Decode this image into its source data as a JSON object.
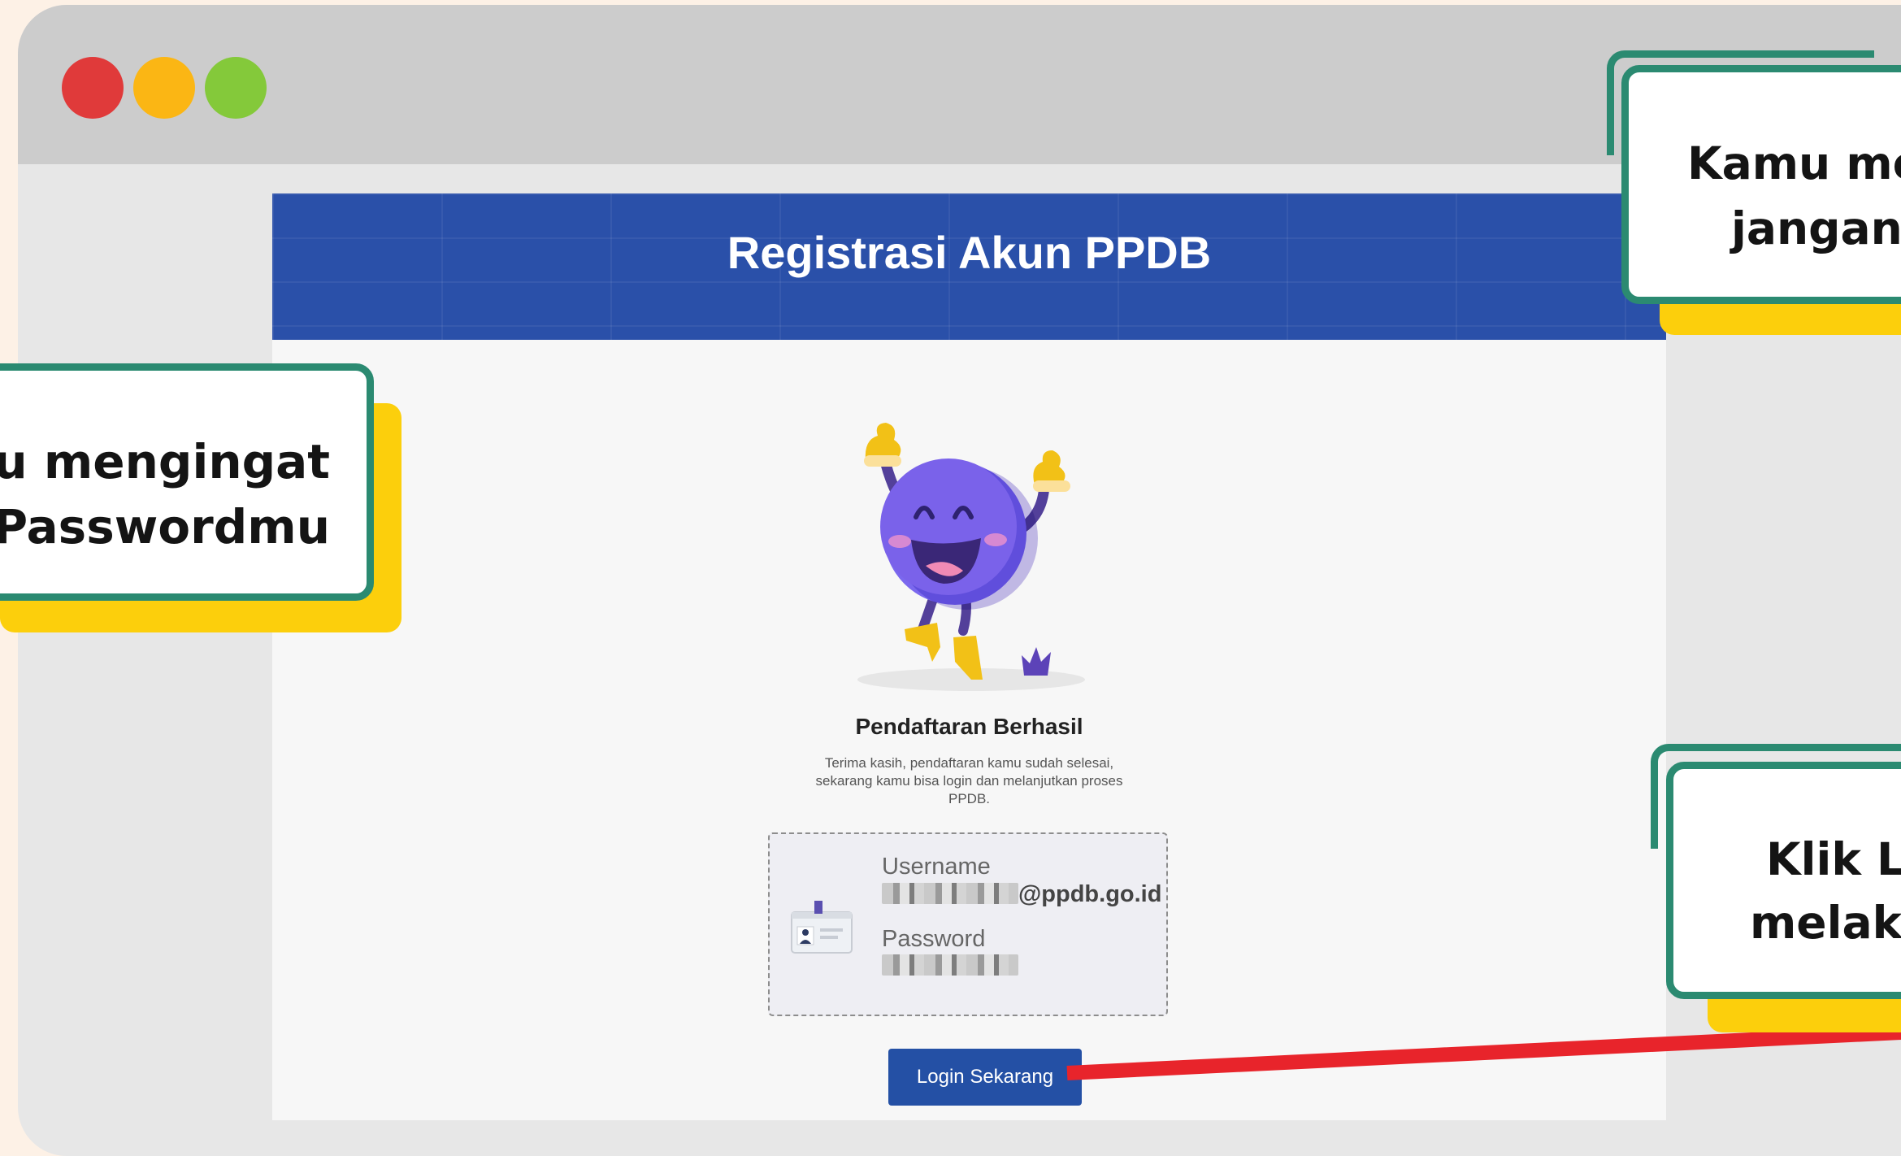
{
  "page": {
    "header_title": "Registrasi Akun PPDB",
    "success_title": "Pendaftaran Berhasil",
    "success_message": "Terima kasih, pendaftaran kamu sudah selesai, sekarang kamu bisa login dan melanjutkan proses PPDB.",
    "credentials": {
      "username_label": "Username",
      "username_domain": "@ppdb.go.id",
      "password_label": "Password"
    },
    "login_button": "Login Sekarang"
  },
  "callouts": {
    "left": {
      "line1": "u mengingat",
      "line2": "Passwordmu"
    },
    "top_right": {
      "line1": "Kamu me",
      "line2": "jangan"
    },
    "bottom_right": {
      "line1": "Klik Lo",
      "line2": "melaku"
    }
  },
  "colors": {
    "header": "#2a50a9",
    "button": "#2450a5",
    "callout_border": "#2b8a71",
    "callout_shadow": "#fccf0c",
    "pointer_line": "#e8242b"
  }
}
